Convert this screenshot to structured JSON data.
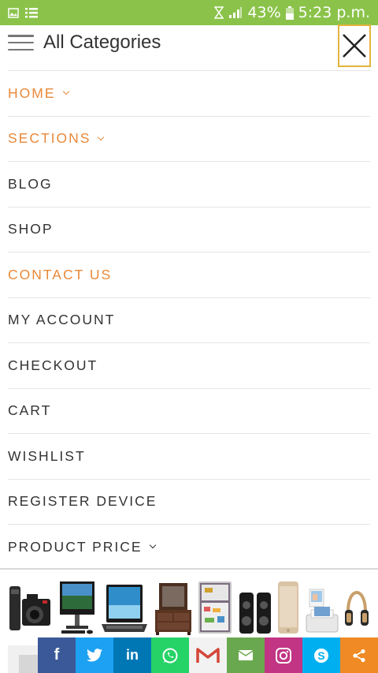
{
  "status_bar": {
    "battery_percent": "43%",
    "time": "5:23 p.m."
  },
  "header": {
    "title": "All Categories"
  },
  "menu": {
    "items": [
      {
        "label": "HOME",
        "has_dropdown": true,
        "accent": true
      },
      {
        "label": "SECTIONS",
        "has_dropdown": true,
        "accent": true
      },
      {
        "label": "BLOG",
        "has_dropdown": false,
        "accent": false
      },
      {
        "label": "SHOP",
        "has_dropdown": false,
        "accent": false
      },
      {
        "label": "CONTACT US",
        "has_dropdown": false,
        "accent": true
      },
      {
        "label": "MY ACCOUNT",
        "has_dropdown": false,
        "accent": false
      },
      {
        "label": "CHECKOUT",
        "has_dropdown": false,
        "accent": false
      },
      {
        "label": "CART",
        "has_dropdown": false,
        "accent": false
      },
      {
        "label": "WISHLIST",
        "has_dropdown": false,
        "accent": false
      },
      {
        "label": "REGISTER DEVICE",
        "has_dropdown": false,
        "accent": false
      },
      {
        "label": "PRODUCT PRICE",
        "has_dropdown": true,
        "accent": false
      }
    ]
  },
  "colors": {
    "status_bar": "#8bc34a",
    "accent": "#e8893a",
    "close_border": "#e3b33c",
    "text": "#333333"
  },
  "banner": {
    "products": [
      "cameras",
      "all-in-one-desktop",
      "laptop",
      "dresser",
      "refrigerator",
      "speakers",
      "smartphone",
      "photo-printer",
      "headphones"
    ]
  },
  "share_bar": {
    "buttons": [
      {
        "name": "facebook",
        "glyph": "f",
        "color": "#3b5998"
      },
      {
        "name": "twitter",
        "glyph": "",
        "color": "#1da1f2"
      },
      {
        "name": "linkedin",
        "glyph": "in",
        "color": "#0077b5"
      },
      {
        "name": "whatsapp",
        "glyph": "",
        "color": "#25d366"
      },
      {
        "name": "gmail",
        "glyph": "M",
        "color": "#f2f2f2"
      },
      {
        "name": "email",
        "glyph": "",
        "color": "#6aa84f"
      },
      {
        "name": "instagram",
        "glyph": "",
        "color": "#c13584"
      },
      {
        "name": "skype",
        "glyph": "S",
        "color": "#00aff0"
      },
      {
        "name": "share",
        "glyph": "",
        "color": "#f08a24"
      }
    ]
  }
}
